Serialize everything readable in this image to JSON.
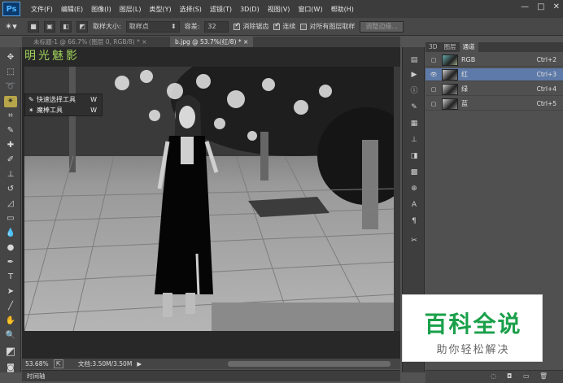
{
  "app": {
    "logo": "Ps"
  },
  "menubar": {
    "items": [
      "文件(F)",
      "编辑(E)",
      "图像(I)",
      "图层(L)",
      "类型(Y)",
      "选择(S)",
      "滤镜(T)",
      "3D(D)",
      "视图(V)",
      "窗口(W)",
      "帮助(H)"
    ],
    "window_controls": [
      "—",
      "□",
      "✕"
    ]
  },
  "options_bar": {
    "sample_size_label": "取样大小:",
    "sample_size_value": "取样点",
    "tolerance_label": "容差:",
    "tolerance_value": "32",
    "antialias_label": "消除锯齿",
    "contiguous_label": "连续",
    "all_layers_label": "对所有图层取样",
    "refine_edge_button": "调整边缘..."
  },
  "document_tabs": [
    {
      "label": "未标题-1 @ 66.7% (图层 0, RGB/8) *",
      "active": false
    },
    {
      "label": "b.jpg @ 53.7%(红/8) *",
      "active": true
    }
  ],
  "tool_flyout": {
    "items": [
      {
        "icon": "quick-selection-icon",
        "label": "快速选择工具",
        "key": "W",
        "selected": false
      },
      {
        "icon": "magic-wand-icon",
        "label": "魔棒工具",
        "key": "W",
        "selected": true
      }
    ]
  },
  "canvas_overlay_text": "明光魅影",
  "status_bar": {
    "zoom": "53.68%",
    "doc_info": "文档:3.50M/3.50M"
  },
  "timeline_label": "时间轴",
  "channels_panel": {
    "tabs": [
      "3D",
      "图层",
      "通道"
    ],
    "active_tab": "通道",
    "channels": [
      {
        "name": "RGB",
        "shortcut": "Ctrl+2",
        "selected": false
      },
      {
        "name": "红",
        "shortcut": "Ctrl+3",
        "selected": true
      },
      {
        "name": "绿",
        "shortcut": "Ctrl+4",
        "selected": false
      },
      {
        "name": "蓝",
        "shortcut": "Ctrl+5",
        "selected": false
      }
    ]
  },
  "watermark": {
    "main_text": "百科全说",
    "sub_text": "助你轻松解决",
    "main_color": "#1aa04a"
  }
}
